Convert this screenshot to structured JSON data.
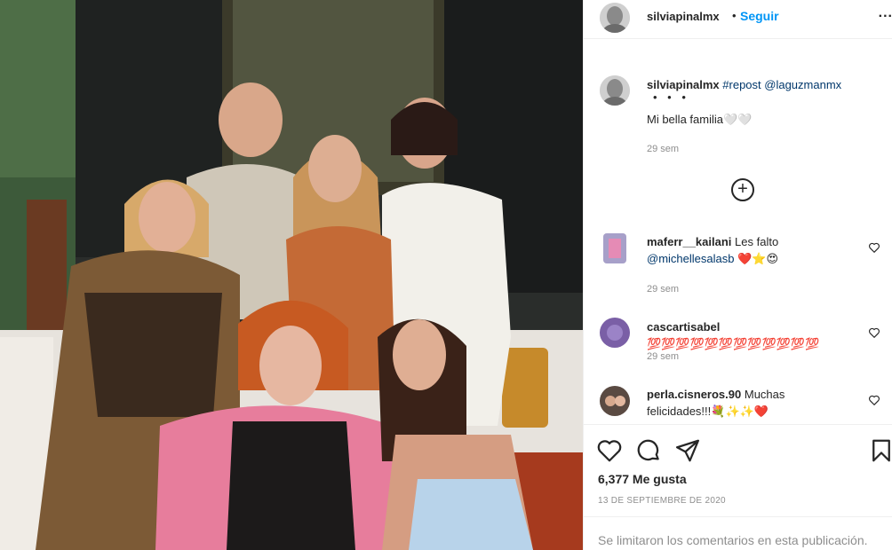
{
  "post": {
    "username": "silviapinalmx",
    "separator": "•",
    "follow_label": "Seguir",
    "more_label": "...",
    "caption": {
      "username": "silviapinalmx",
      "tags": "#repost @laguzmanmx",
      "dots": "• • •",
      "text": "Mi bella familia🤍🤍",
      "time": "29 sem"
    },
    "load_more_label": "+",
    "comments": [
      {
        "username": "maferr__kailani",
        "text": "Les falto",
        "mention": "@michellesalasb",
        "emoji": "❤️⭐😍",
        "time": "29 sem"
      },
      {
        "username": "cascartisabel",
        "text": "💯💯💯💯💯💯💯💯💯💯💯💯",
        "time": "29 sem"
      },
      {
        "username": "perla.cisneros.90",
        "text": "Muchas",
        "text2": "felicidades!!!💐✨✨❤️"
      }
    ],
    "likes": "6,377 Me gusta",
    "date": "13 DE SEPTIEMBRE DE 2020",
    "comments_limited": "Se limitaron los comentarios en esta publicación."
  },
  "icons": [
    "heart-icon",
    "comment-icon",
    "share-icon",
    "bookmark-icon",
    "plus-circle-icon",
    "more-icon"
  ],
  "colors": {
    "link": "#0095f6",
    "tag": "#00376b",
    "muted": "#8e8e8e",
    "text": "#262626"
  }
}
